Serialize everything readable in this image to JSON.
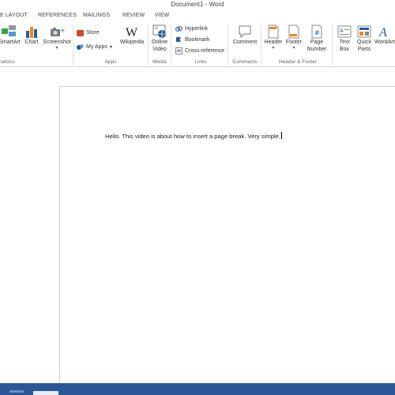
{
  "window": {
    "title": "Document1 - Word"
  },
  "tabs": [
    "E LAYOUT",
    "REFERENCES",
    "MAILINGS",
    "REVIEW",
    "VIEW"
  ],
  "ribbon": {
    "smartart": "SmartArt",
    "chart": "Chart",
    "screenshot": "Screenshot",
    "store": "Store",
    "my_apps": "My Apps",
    "wikipedia": "Wikipedia",
    "online_video_line1": "Online",
    "online_video_line2": "Video",
    "hyperlink": "Hyperlink",
    "bookmark": "Bookmark",
    "cross_reference": "Cross-reference",
    "comment": "Comment",
    "header": "Header",
    "footer": "Footer",
    "page_number_line1": "Page",
    "page_number_line2": "Number",
    "text_box_line1": "Text",
    "text_box_line2": "Box",
    "quick_parts_line1": "Quick",
    "quick_parts_line2": "Parts",
    "wordart": "WordArt",
    "groups": {
      "illustrations": "rations",
      "apps": "Apps",
      "media": "Media",
      "links": "Links",
      "comments": "Comments",
      "header_footer": "Header & Footer"
    }
  },
  "document": {
    "body_text": "Hello. This video is about how to insert a page break. Very simple."
  },
  "colors": {
    "accent": "#2b579a",
    "store_orange": "#d24726",
    "icon_blue": "#2b579a"
  }
}
